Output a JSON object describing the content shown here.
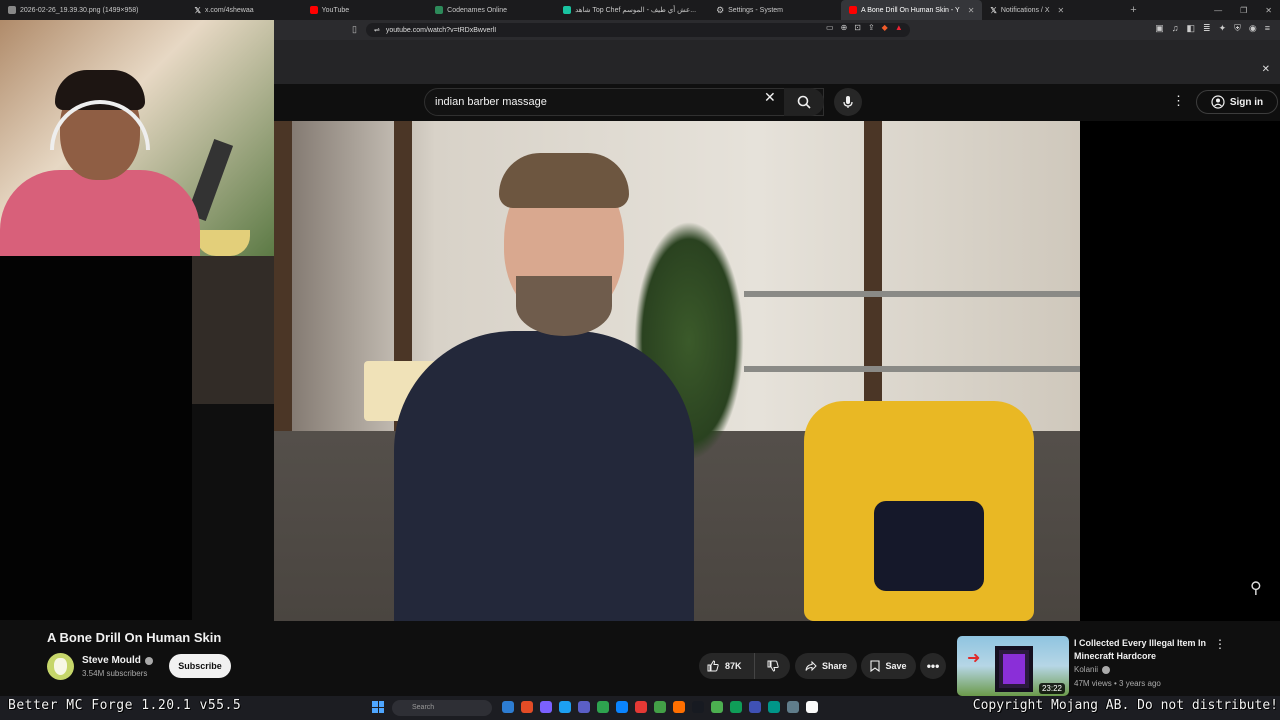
{
  "browser": {
    "tabs": [
      {
        "label": "2026-02-26_19.39.30.png (1499×958)",
        "color": "#888888"
      },
      {
        "label": "x.com/4shewaa",
        "color": "#ffffff"
      },
      {
        "label": "YouTube",
        "color": "#ff0000"
      },
      {
        "label": "Codenames Online",
        "color": "#2d8a5a"
      },
      {
        "label": "شاهد Top Chef عش أي طيف - الموسم...",
        "color": "#19c3a0"
      },
      {
        "label": "Settings - System",
        "color": "#aaaaaa"
      },
      {
        "label": "A Bone Drill On Human Skin - Y",
        "color": "#ff0000",
        "active": true
      },
      {
        "label": "Notifications / X",
        "color": "#ffffff"
      }
    ],
    "url": "youtube.com/watch?v=tRDxBwverlI"
  },
  "youtube": {
    "search_value": "indian barber massage",
    "signin_label": "Sign in"
  },
  "video": {
    "title": "A Bone Drill On Human Skin",
    "channel": "Steve Mould",
    "subscribers": "3.54M subscribers",
    "subscribe_label": "Subscribe",
    "likes": "87K",
    "share_label": "Share",
    "save_label": "Save"
  },
  "recommended": {
    "title": "I Collected Every Illegal Item In Minecraft Hardcore",
    "channel": "Kolanii",
    "stats": "47M views • 3 years ago",
    "duration": "23:22"
  },
  "taskbar": {
    "search_placeholder": "Search",
    "overlay_left": "Better MC Forge 1.20.1 v55.5",
    "overlay_right": "Copyright Mojang AB. Do not distribute!",
    "icon_colors": [
      "#2d7dd2",
      "#e34c26",
      "#7b61ff",
      "#1ca0f2",
      "#5b5fc7",
      "#2ea44f",
      "#0a84ff",
      "#e53935",
      "#43a047",
      "#ff6f00",
      "#171a21",
      "#4caf50",
      "#0f9d58",
      "#3f51b5",
      "#009688",
      "#607d8b",
      "#fafafa"
    ]
  }
}
